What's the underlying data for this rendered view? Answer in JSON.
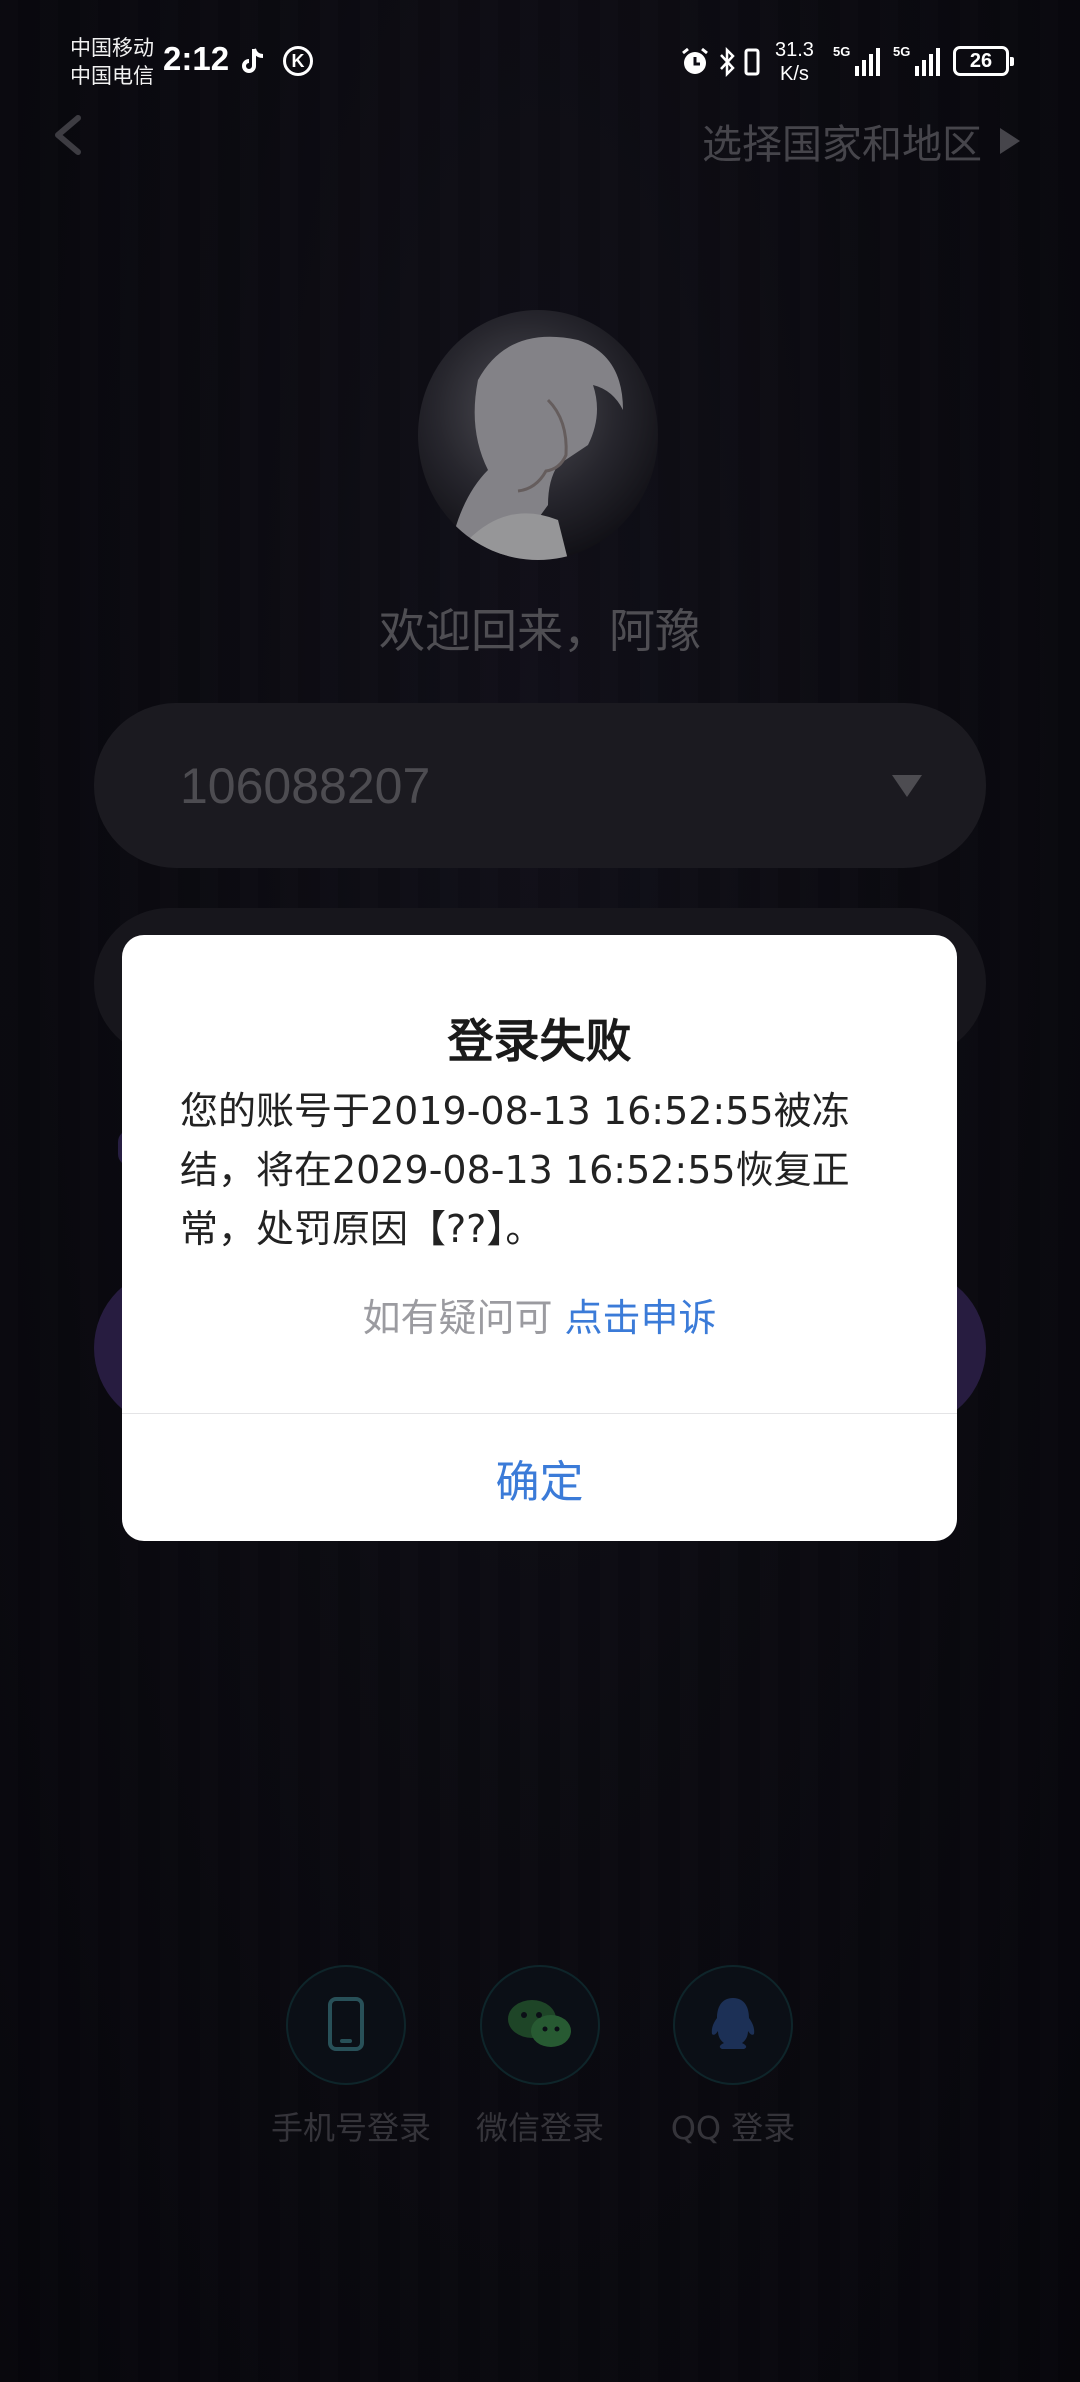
{
  "status_bar": {
    "carrier_1": "中国移动",
    "carrier_2": "中国电信",
    "time": "2:12",
    "net_speed_value": "31.3",
    "net_speed_unit": "K/s",
    "signal_1_tag": "5G",
    "signal_2_tag": "5G",
    "battery": "26",
    "icons": [
      "tiktok-icon",
      "k-app-icon",
      "alarm-icon",
      "bluetooth-icon",
      "vibrate-icon",
      "signal-icon",
      "battery-icon"
    ]
  },
  "header": {
    "back_icon": "chevron-left-icon",
    "region_label": "选择国家和地区"
  },
  "welcome_text": "欢迎回来，阿豫",
  "account": {
    "value": "106088207"
  },
  "social_logins": [
    {
      "label": "手机号登录",
      "icon": "phone-icon"
    },
    {
      "label": "微信登录",
      "icon": "wechat-icon"
    },
    {
      "label": "QQ 登录",
      "icon": "qq-icon"
    }
  ],
  "dialog": {
    "title": "登录失败",
    "message": "您的账号于2019-08-13 16:52:55被冻结，将在2029-08-13 16:52:55恢复正常，处罚原因【??】。",
    "appeal_prefix": "如有疑问可 ",
    "appeal_link": "点击申诉",
    "confirm_label": "确定"
  },
  "colors": {
    "background": "#0d0c15",
    "link_blue": "#3b7bd8",
    "login_purple": "#3d2c63",
    "social_border": "#163a41"
  }
}
